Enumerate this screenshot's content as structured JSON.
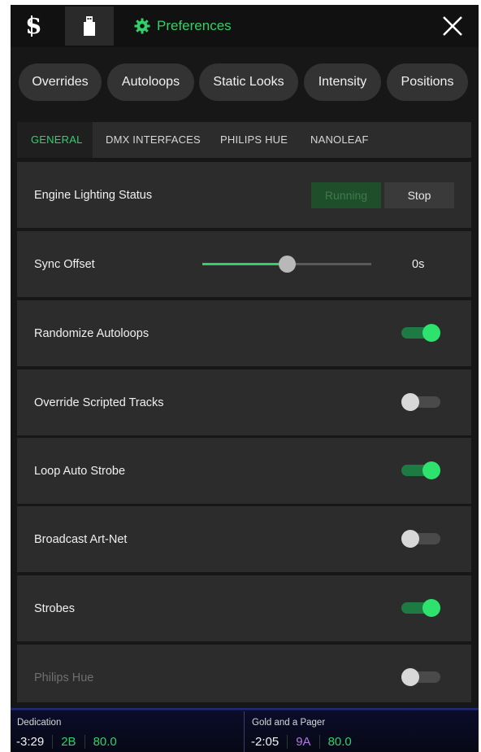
{
  "header": {
    "title": "Preferences",
    "accent_color": "#31d06a",
    "icons": [
      "soundswitch-logo-icon",
      "usb-drive-icon",
      "gear-icon",
      "close-icon"
    ]
  },
  "pills": [
    "Overrides",
    "Autoloops",
    "Static Looks",
    "Intensity",
    "Positions"
  ],
  "tabs": [
    "GENERAL",
    "DMX INTERFACES",
    "PHILIPS HUE",
    "NANOLEAF"
  ],
  "active_tab": "GENERAL",
  "settings": {
    "engine_status": {
      "label": "Engine Lighting Status",
      "running": "Running",
      "stop": "Stop"
    },
    "sync_offset": {
      "label": "Sync Offset",
      "value": "0s",
      "level": 0.5
    },
    "randomize_autoloops": {
      "label": "Randomize Autoloops",
      "on": true
    },
    "override_scripted_tracks": {
      "label": "Override Scripted Tracks",
      "on": false
    },
    "loop_auto_strobe": {
      "label": "Loop Auto Strobe",
      "on": true
    },
    "broadcast_artnet": {
      "label": "Broadcast Art-Net",
      "on": false
    },
    "strobes": {
      "label": "Strobes",
      "on": true
    },
    "philips_hue": {
      "label": "Philips Hue",
      "on": false,
      "disabled": true
    }
  },
  "decks": [
    {
      "title": "Dedication",
      "time": "-3:29",
      "key": "2B",
      "key_color": "#31d06a",
      "bpm": "80.0"
    },
    {
      "title": "Gold and a Pager",
      "time": "-2:05",
      "key": "9A",
      "key_color": "#b07ae6",
      "bpm": "80.0"
    }
  ]
}
